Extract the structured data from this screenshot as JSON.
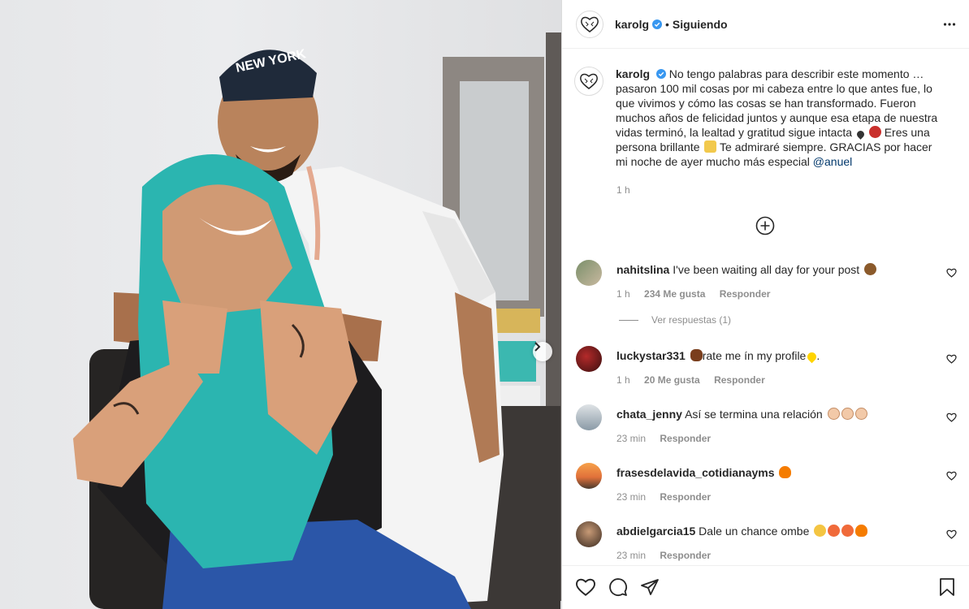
{
  "post": {
    "username": "karolg",
    "follow_status": "Siguiendo",
    "separator": "•",
    "caption_text": "No tengo palabras para describir este momento … pasaron 100 mil cosas por mi cabeza entre lo que antes fue, lo que vivimos y cómo las cosas se han transformado. Fueron muchos años de felicidad juntos y aunque esa etapa de nuestra vidas terminó, la lealtad y gratitud sigue intacta",
    "caption_text_2": "Eres una persona brillante",
    "caption_text_3": "Te admiraré siempre. GRACIAS por hacer mi noche de ayer mucho más especial",
    "caption_mention": "@anuel",
    "caption_time": "1 h"
  },
  "comments": [
    {
      "username": "nahitslina",
      "text": "I've been waiting all day for your post",
      "time": "1 h",
      "likes": "234 Me gusta",
      "reply": "Responder",
      "emoji_colors": [
        "#8b5a2b"
      ]
    },
    {
      "username": "luckystar331",
      "text_before": "",
      "text": "rate me ín my profile",
      "text_after": ".",
      "time": "1 h",
      "likes": "20 Me gusta",
      "reply": "Responder",
      "emoji_colors": [
        "#7a3e1d",
        "#ffd400"
      ]
    },
    {
      "username": "chata_jenny",
      "text": "Así se termina una relación",
      "time": "23 min",
      "reply": "Responder",
      "emoji_colors": [
        "#f2c9a8",
        "#f2c9a8",
        "#f2c9a8"
      ]
    },
    {
      "username": "frasesdelavida_cotidianayms",
      "text": "",
      "time": "23 min",
      "reply": "Responder",
      "emoji_colors": [
        "#f57c00"
      ]
    },
    {
      "username": "abdielgarcia15",
      "text": "Dale un chance ombe",
      "time": "23 min",
      "reply": "Responder",
      "emoji_colors": [
        "#f4c542",
        "#f06a3a",
        "#f06a3a",
        "#f57c00"
      ]
    }
  ],
  "view_replies": "Ver respuestas (1)",
  "icons": {
    "avatar": "heart-logo-icon",
    "verified": "verified-badge-icon",
    "more": "more-options-icon",
    "load_more": "plus-circle-icon",
    "like": "heart-outline-icon",
    "comment": "comment-bubble-icon",
    "share": "paper-plane-icon",
    "save": "bookmark-icon",
    "next": "chevron-right-icon"
  },
  "colors": {
    "verified_blue": "#3897f0",
    "hair_teal": "#2bb5b0",
    "mention_blue": "#00376b"
  }
}
